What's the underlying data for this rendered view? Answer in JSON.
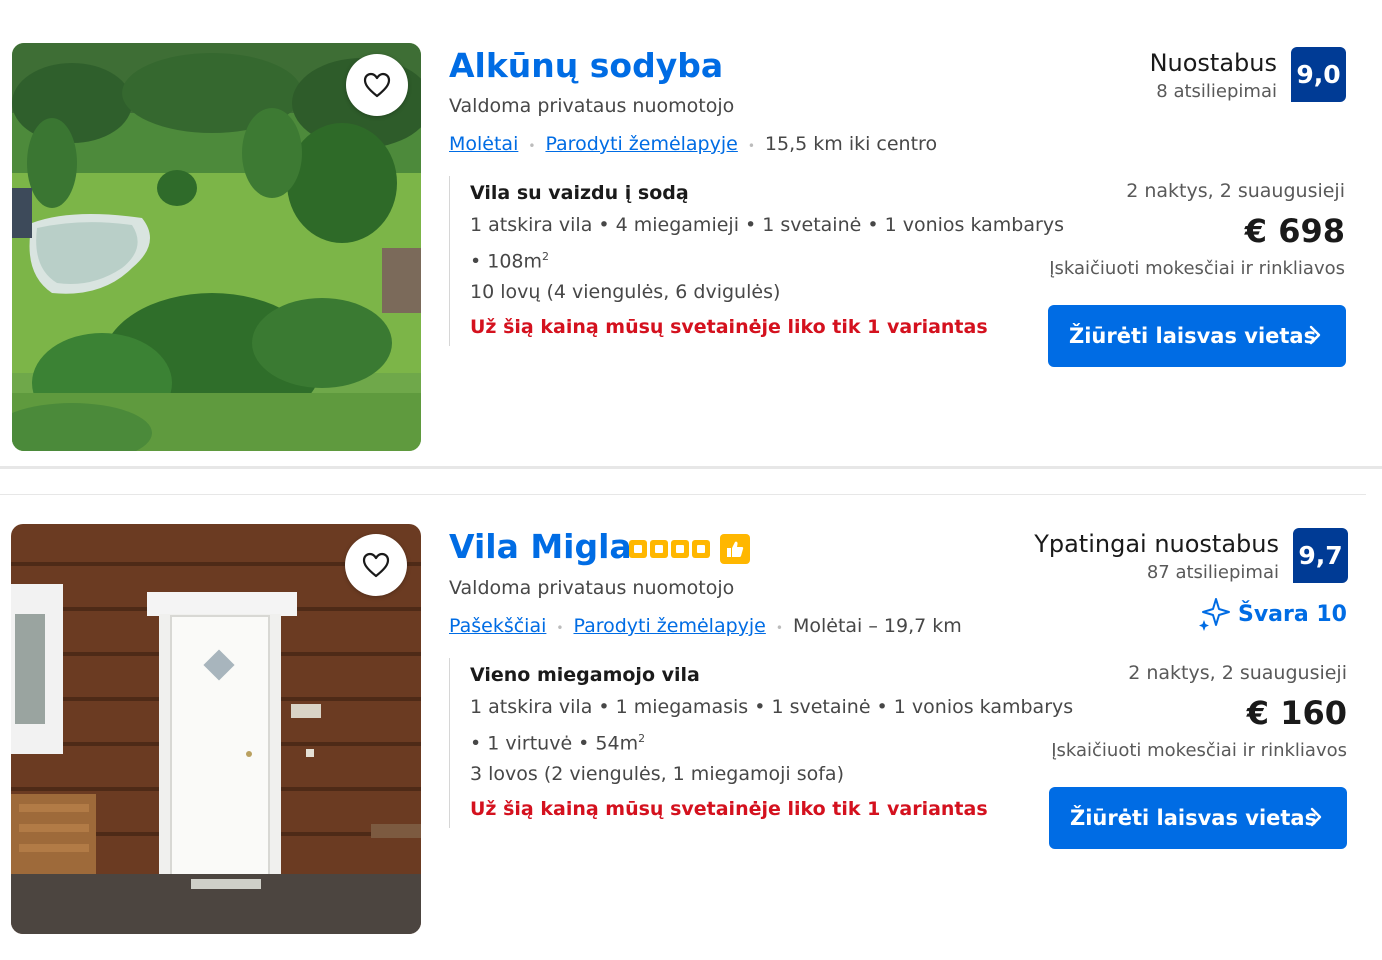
{
  "listings": [
    {
      "title": "Alkūnų sodyba",
      "host_type": "Valdoma privataus nuomotojo",
      "location_link": "Molėtai",
      "map_link": "Parodyti žemėlapyje",
      "distance": "15,5 km iki centro",
      "room_name": "Vila su vaizdu į sodą",
      "room_details_1": "1 atskira vila • 4 miegamieji • 1 svetainė • 1 vonios kambarys",
      "room_details_2": "• 108m",
      "room_details_2_sup": "2",
      "beds": "10 lovų (4 viengulės, 6 dvigulės)",
      "urgency": "Už šią kainą mūsų svetainėje liko tik 1 variantas",
      "review_word": "Nuostabus",
      "review_count": "8 atsiliepimai",
      "score": "9,0",
      "nights": "2 naktys, 2 suaugusieji",
      "price": "€ 698",
      "taxes": "Įskaičiuoti mokesčiai ir rinkliavos",
      "cta": "Žiūrėti laisvas vietas"
    },
    {
      "title": "Vila Migla",
      "host_type": "Valdoma privataus nuomotojo",
      "location_link": "Pašekščiai",
      "map_link": "Parodyti žemėlapyje",
      "distance": "Molėtai – 19,7 km",
      "room_name": "Vieno miegamojo vila",
      "room_details_1": "1 atskira vila • 1 miegamasis • 1 svetainė • 1 vonios kambarys",
      "room_details_2": "• 1 virtuvė • 54m",
      "room_details_2_sup": "2",
      "beds": "3 lovos (2 viengulės, 1 miegamoji sofa)",
      "urgency": "Už šią kainą mūsų svetainėje liko tik 1 variantas",
      "review_word": "Ypatingai nuostabus",
      "review_count": "87 atsiliepimai",
      "score": "9,7",
      "genius_label": "Švara 10",
      "star_rating": 4,
      "nights": "2 naktys, 2 suaugusieji",
      "price": "€ 160",
      "taxes": "Įskaičiuoti mokesčiai ir rinkliavos",
      "cta": "Žiūrėti laisvas vietas"
    }
  ],
  "icons": {
    "favorite": "heart-icon",
    "cta_arrow": "chevron-right-icon",
    "stars": "star-rating-icon",
    "thumbs_up": "thumbs-up-icon",
    "sparkle": "sparkle-icon"
  },
  "colors": {
    "link_blue": "#006ce4",
    "score_navy": "#003b95",
    "urgency_red": "#d4111e",
    "star_yellow": "#ffb700"
  }
}
